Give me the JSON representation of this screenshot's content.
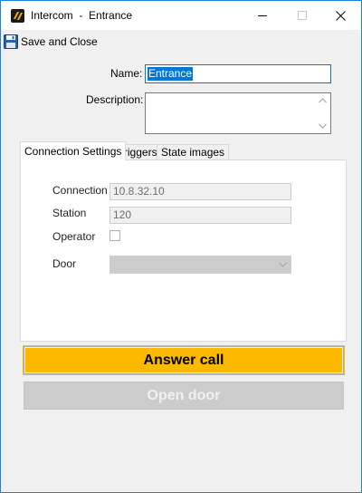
{
  "window": {
    "title": "Intercom  -  Entrance",
    "icons": [
      "app-icon",
      "minimize-icon",
      "maximize-icon",
      "close-icon"
    ]
  },
  "toolbar": {
    "save_close_label": "Save and Close",
    "save_icon": "floppy-disk-icon"
  },
  "form": {
    "name_label": "Name:",
    "name_value": "Entrance",
    "description_label": "Description:",
    "description_value": ""
  },
  "tabs": [
    {
      "label": "Connection Settings",
      "active": true
    },
    {
      "label": "Triggers",
      "active": false
    },
    {
      "label": "State images",
      "active": false
    }
  ],
  "connection": {
    "connection_label": "Connection",
    "connection_value": "10.8.32.10",
    "station_label": "Station",
    "station_value": "120",
    "operator_label": "Operator",
    "operator_checked": false,
    "door_label": "Door",
    "door_value": ""
  },
  "buttons": {
    "answer_call": "Answer call",
    "open_door": "Open door"
  },
  "colors": {
    "accent_yellow": "#fcb900",
    "selection_blue": "#0078d7",
    "window_border": "#1883d7"
  }
}
